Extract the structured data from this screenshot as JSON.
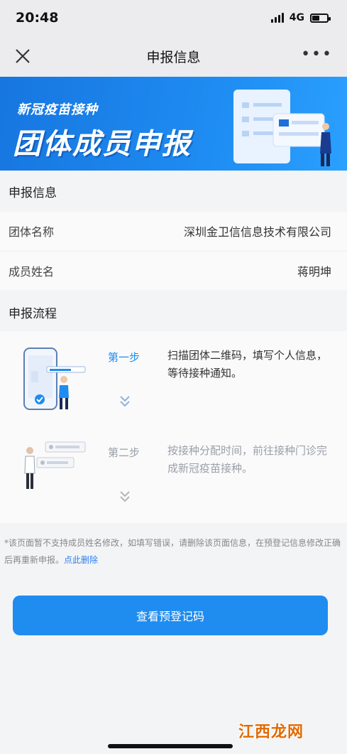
{
  "status_bar": {
    "time": "20:48",
    "network": "4G"
  },
  "nav": {
    "title": "申报信息",
    "close_icon": "close-icon",
    "more_icon": "more-dots-icon"
  },
  "banner": {
    "subtitle": "新冠疫苗接种",
    "title": "团体成员申报"
  },
  "declaration": {
    "header": "申报信息",
    "fields": [
      {
        "label": "团体名称",
        "value": "深圳金卫信信息技术有限公司"
      },
      {
        "label": "成员姓名",
        "value": "蒋明坤"
      }
    ]
  },
  "flow": {
    "header": "申报流程",
    "steps": [
      {
        "name": "第一步",
        "desc": "扫描团体二维码，填写个人信息，等待接种通知。",
        "active": true
      },
      {
        "name": "第二步",
        "desc": "按接种分配时间，前往接种门诊完成新冠疫苗接种。",
        "active": false
      }
    ]
  },
  "note": {
    "text": "*该页面暂不支持成员姓名修改，如填写错误，请删除该页面信息，在预登记信息修改正确后再重新申报。",
    "link": "点此删除"
  },
  "button": {
    "label": "查看预登记码"
  },
  "watermark": "江西龙网",
  "colors": {
    "primary": "#1f8cf0",
    "banner": "#1776e0",
    "link": "#2f80ed"
  }
}
